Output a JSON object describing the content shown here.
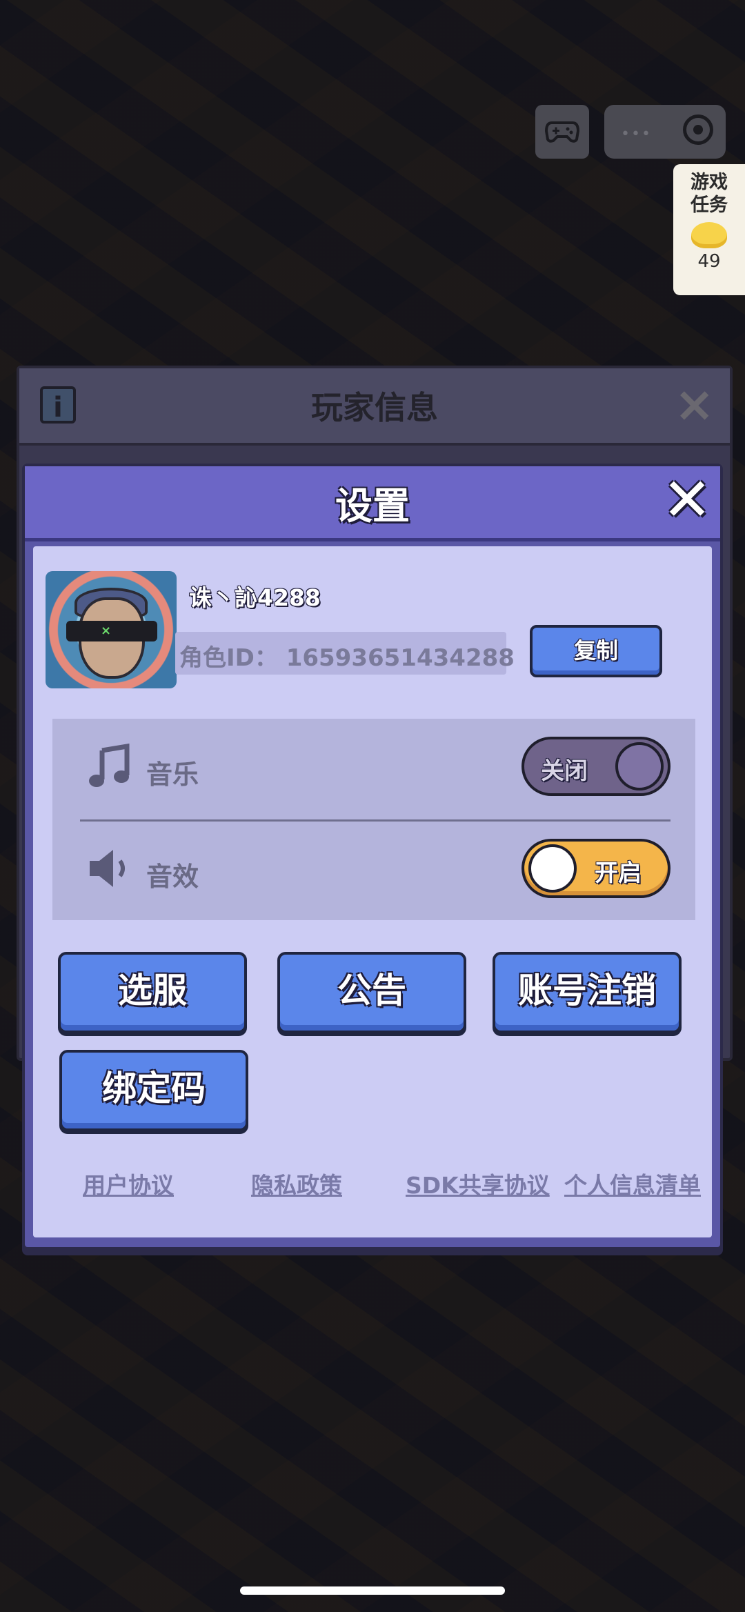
{
  "top_right": {
    "gamepad_icon": "gamepad-icon",
    "capsule_icons": [
      "more-dots-icon",
      "target-icon"
    ],
    "task_card": {
      "label": "游戏任务",
      "count": "49",
      "icon": "gold-coin-icon"
    }
  },
  "player_panel": {
    "title": "玩家信息",
    "info_icon_text": "i",
    "close_icon": "×"
  },
  "settings": {
    "title": "设置",
    "close_icon": "✕",
    "profile": {
      "username": "诛丶訫4288",
      "role_id": "角色ID：  16593651434288",
      "copy_label": "复制"
    },
    "sound": {
      "music_label": "音乐",
      "music_toggle": "关闭",
      "sfx_label": "音效",
      "sfx_toggle": "开启"
    },
    "buttons": {
      "server": "选服",
      "notice": "公告",
      "cancel_account": "账号注销",
      "bind_code": "绑定码"
    },
    "links": {
      "user_agreement": "用户协议",
      "privacy_policy": "隐私政策",
      "sdk_sharing": "SDK共享协议",
      "personal_info": "个人信息清单"
    }
  },
  "colors": {
    "dialog_header": "#6c66c6",
    "dialog_body": "#ccccf4",
    "button_blue": "#5b86ea",
    "toggle_on": "#f4b54a",
    "toggle_off": "#6f638a"
  }
}
